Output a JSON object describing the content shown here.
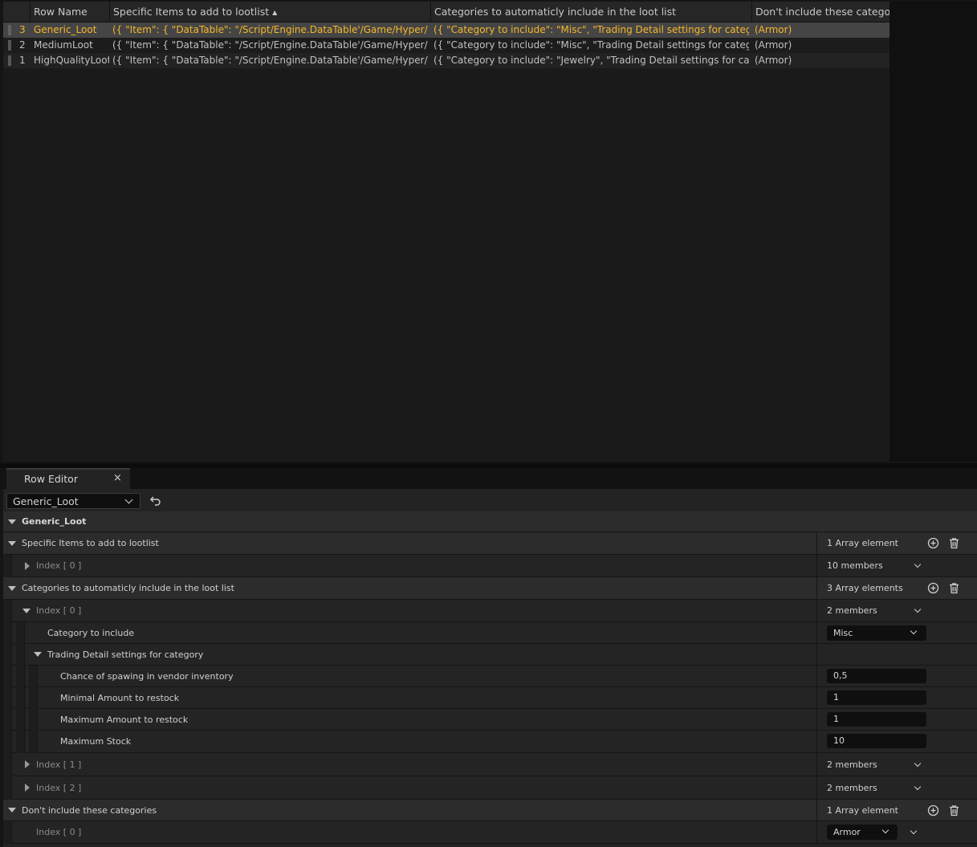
{
  "table": {
    "columns": [
      {
        "label": "Row Name"
      },
      {
        "label": "Specific Items to add to lootlist",
        "sort": "▲"
      },
      {
        "label": "Categories to automaticly include in the loot list"
      },
      {
        "label": "Don't include these categorie"
      }
    ],
    "rows": [
      {
        "num": "3",
        "name": "Generic_Loot",
        "items": "({ \"Item\": { \"DataTable\": \"/Script/Engine.DataTable'/Game/Hyper/Inventory",
        "categories": "({ \"Category to include\": \"Misc\", \"Trading Detail settings for category\": { \"C",
        "exclude": "(Armor)",
        "selected": true
      },
      {
        "num": "2",
        "name": "MediumLoot",
        "items": "({ \"Item\": { \"DataTable\": \"/Script/Engine.DataTable'/Game/Hyper/Inventory",
        "categories": "({ \"Category to include\": \"Misc\", \"Trading Detail settings for category\": { \"C",
        "exclude": "(Armor)"
      },
      {
        "num": "1",
        "name": "HighQualityLoot",
        "items": "({ \"Item\": { \"DataTable\": \"/Script/Engine.DataTable'/Game/Hyper/Inventory",
        "categories": "({ \"Category to include\": \"Jewelry\", \"Trading Detail settings for category\": {",
        "exclude": "(Armor)"
      }
    ]
  },
  "editor": {
    "tab_label": "Row Editor",
    "close_glyph": "×",
    "row_selector_value": "Generic_Loot",
    "section_title": "Generic_Loot",
    "specific_items": {
      "label": "Specific Items to add to lootlist",
      "count": "1 Array element",
      "index0": "Index [ 0 ]",
      "index0_members": "10 members"
    },
    "categories": {
      "label": "Categories to automaticly include in the loot list",
      "count": "3 Array elements",
      "index0": "Index [ 0 ]",
      "index0_members": "2 members",
      "category_label": "Category to include",
      "category_value": "Misc",
      "trading_label": "Trading Detail settings for category",
      "chance_label": "Chance of spawing in vendor inventory",
      "chance_value": "0,5",
      "min_label": "Minimal Amount to restock",
      "min_value": "1",
      "max_label": "Maximum Amount to restock",
      "max_value": "1",
      "stock_label": "Maximum Stock",
      "stock_value": "10",
      "index1": "Index [ 1 ]",
      "index1_members": "2 members",
      "index2": "Index [ 2 ]",
      "index2_members": "2 members"
    },
    "exclude": {
      "label": "Don't include these categories",
      "count": "1 Array element",
      "index0": "Index [ 0 ]",
      "index0_value": "Armor"
    }
  }
}
